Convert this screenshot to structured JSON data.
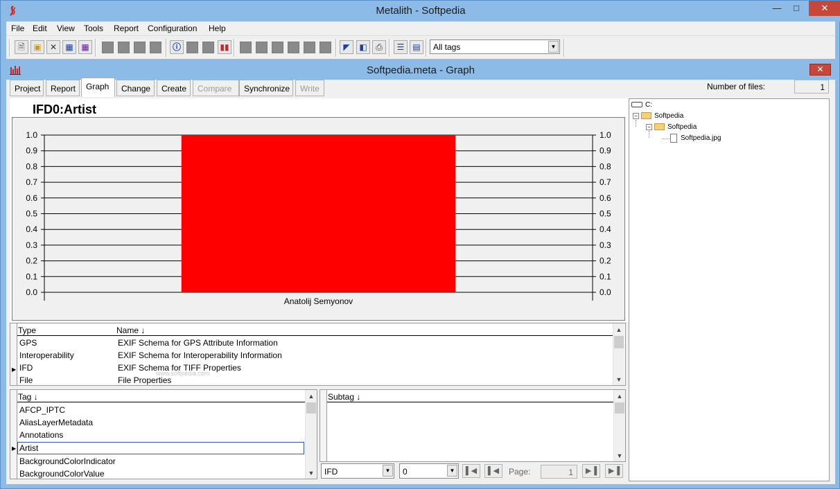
{
  "app": {
    "title": "Metalith - Softpedia"
  },
  "menu": [
    "File",
    "Edit",
    "View",
    "Tools",
    "Report",
    "Configuration",
    "Help"
  ],
  "toolbar": {
    "tag_filter": "All tags"
  },
  "child_window": {
    "title": "Softpedia.meta - Graph"
  },
  "tabs": [
    {
      "label": "Project",
      "state": "normal"
    },
    {
      "label": "Report",
      "state": "normal"
    },
    {
      "label": "Graph",
      "state": "active"
    },
    {
      "label": "Change",
      "state": "normal"
    },
    {
      "label": "Create",
      "state": "normal"
    },
    {
      "label": "Compare",
      "state": "disabled"
    },
    {
      "label": "Synchronize",
      "state": "normal"
    },
    {
      "label": "Write",
      "state": "disabled"
    }
  ],
  "files": {
    "label": "Number of files:",
    "count": "1"
  },
  "graph": {
    "title": "IFD0:Artist"
  },
  "chart_data": {
    "type": "bar",
    "title": "IFD0:Artist",
    "categories": [
      "Anatolij Semyonov"
    ],
    "values": [
      1.0
    ],
    "ylim": [
      0.0,
      1.0
    ],
    "yticks": [
      "0.0",
      "0.1",
      "0.2",
      "0.3",
      "0.4",
      "0.5",
      "0.6",
      "0.7",
      "0.8",
      "0.9",
      "1.0"
    ],
    "bar_color": "#ff0000",
    "grid": true,
    "legend": "none"
  },
  "schema_table": {
    "headers": {
      "type": "Type",
      "name": "Name"
    },
    "rows": [
      {
        "type": "GPS",
        "name": "EXIF Schema for GPS Attribute Information"
      },
      {
        "type": "Interoperability",
        "name": "EXIF Schema for Interoperability Information"
      },
      {
        "type": "IFD",
        "name": "EXIF Schema for TIFF Properties"
      },
      {
        "type": "File",
        "name": "File Properties"
      }
    ]
  },
  "tag_table": {
    "header": "Tag",
    "rows": [
      "AFCP_IPTC",
      "AliasLayerMetadata",
      "Annotations",
      "Artist",
      "BackgroundColorIndicator",
      "BackgroundColorValue"
    ]
  },
  "subtag_table": {
    "header": "Subtag"
  },
  "bottom": {
    "schema_select": "IFD",
    "index_select": "0",
    "page_label": "Page:",
    "page_value": "1"
  },
  "tree": {
    "drive": "C:",
    "folder1": "Softpedia",
    "folder2": "Softpedia",
    "file": "Softpedia.jpg"
  },
  "watermark": "www.softpedia.com",
  "colors": {
    "title_bar": "#8cbbe8",
    "bar": "#ff0000",
    "close": "#c7473a"
  }
}
